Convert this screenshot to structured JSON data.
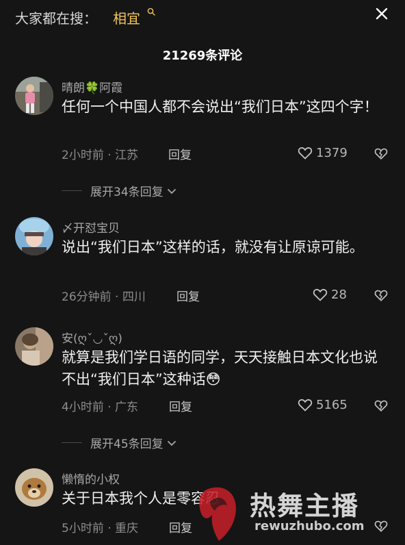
{
  "header": {
    "search_prefix": "大家都在搜：",
    "search_term": "相宜",
    "search_icon": "search-icon",
    "close_icon": "close-icon",
    "comment_count": "21269条评论"
  },
  "comments": [
    {
      "username": "晴朗🍀阿霞",
      "content": "任何一个中国人都不会说出“我们日本”这四个字！",
      "time_location": "2小时前 · 江苏",
      "reply_label": "回复",
      "likes": "1379",
      "expand_label": "展开34条回复"
    },
    {
      "username": "〆开怼宝贝",
      "content": "说出“我们日本”这样的话，就没有让原谅可能。",
      "time_location": "26分钟前 · 四川",
      "reply_label": "回复",
      "likes": "28"
    },
    {
      "username": "安(ღˇ◡ˇღ)",
      "content": "就算是我们学日语的同学，天天接触日本文化也说不出“我们日本”这种话😳",
      "time_location": "4小时前 · 广东",
      "reply_label": "回复",
      "likes": "5165",
      "expand_label": "展开45条回复"
    },
    {
      "username": "懒惰的小权",
      "content": "关于日本我个人是零容忍",
      "time_location": "5小时前 · 重庆",
      "reply_label": "回复",
      "likes": ""
    }
  ],
  "watermark": {
    "text": "热舞主播",
    "url": "rewuzhubo.com"
  },
  "colors": {
    "background": "#151515",
    "accent": "#f2c75c"
  }
}
